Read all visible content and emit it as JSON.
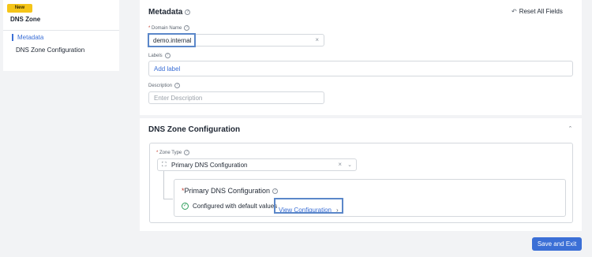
{
  "nav": {
    "badge": "New",
    "title": "DNS Zone",
    "items": [
      {
        "label": "Metadata",
        "active": true
      },
      {
        "label": "DNS Zone Configuration",
        "active": false
      }
    ]
  },
  "metadata": {
    "title": "Metadata",
    "reset_label": "Reset All Fields",
    "domain_name": {
      "label": "Domain Name",
      "required_mark": "*",
      "value": "demo.internal"
    },
    "labels": {
      "label": "Labels",
      "add_link": "Add label"
    },
    "description": {
      "label": "Description",
      "placeholder": "Enter Description"
    }
  },
  "dns_config": {
    "title": "DNS Zone Configuration",
    "collapse_glyph": "ˆ",
    "zone_type": {
      "label": "Zone Type",
      "required_mark": "*",
      "value": "Primary DNS Configuration"
    },
    "primary": {
      "title": "Primary DNS Configuration",
      "required_mark": "*",
      "status_text": "Configured with default values",
      "view_link": "View Configuration"
    }
  },
  "footer": {
    "save_label": "Save and Exit"
  },
  "colors": {
    "accent": "#3b6fd6",
    "badge": "#f5c518",
    "success": "#2e9e5b"
  }
}
